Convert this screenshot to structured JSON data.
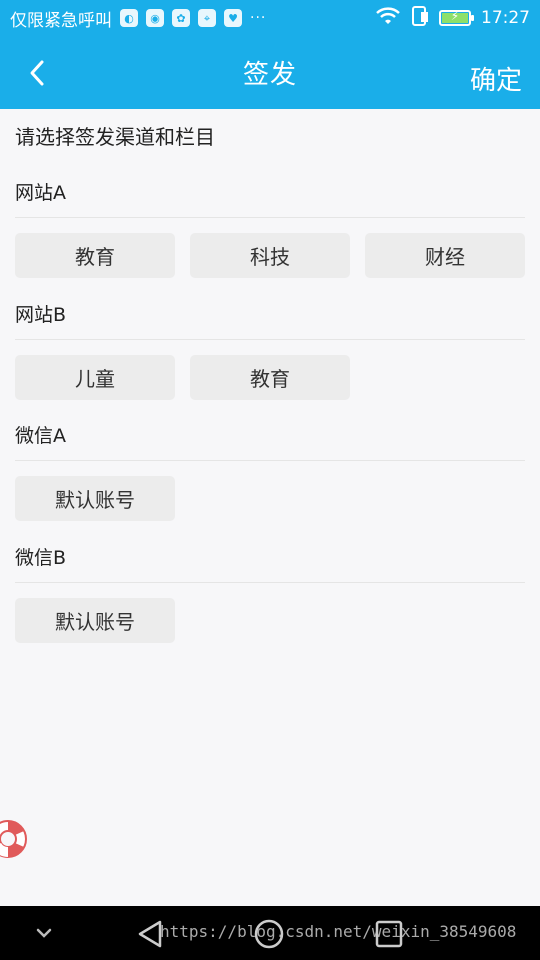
{
  "status_bar": {
    "carrier_text": "仅限紧急呼叫",
    "time": "17:27",
    "more_icon": "···"
  },
  "app_bar": {
    "title": "签发",
    "confirm_label": "确定"
  },
  "hint": "请选择签发渠道和栏目",
  "sections": [
    {
      "title": "网站A",
      "items": [
        "教育",
        "科技",
        "财经"
      ]
    },
    {
      "title": "网站B",
      "items": [
        "儿童",
        "教育"
      ]
    },
    {
      "title": "微信A",
      "items": [
        "默认账号"
      ]
    },
    {
      "title": "微信B",
      "items": [
        "默认账号"
      ]
    }
  ],
  "watermark": "https://blog.csdn.net/weixin_38549608",
  "colors": {
    "accent": "#1aaee9",
    "chip_bg": "#ececec",
    "page_bg": "#f7f7f9"
  }
}
